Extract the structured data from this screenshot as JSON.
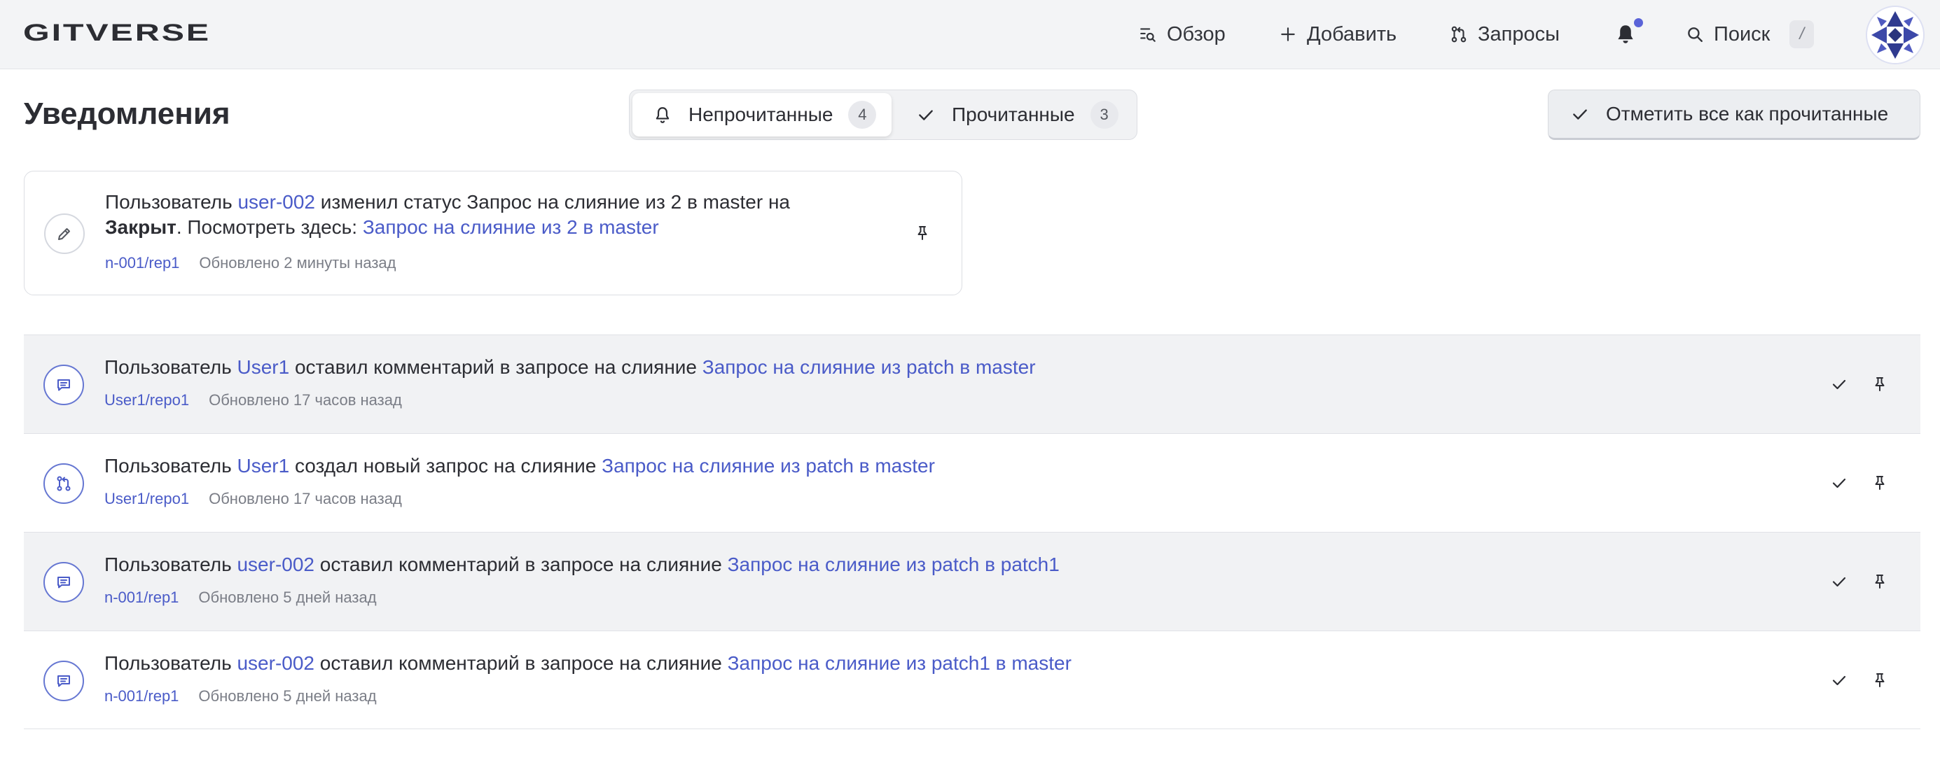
{
  "header": {
    "logo": "GITVERSE",
    "nav": {
      "overview": "Обзор",
      "add": "Добавить",
      "requests": "Запросы",
      "search": "Поиск",
      "search_shortcut": "/"
    }
  },
  "page": {
    "title": "Уведомления",
    "tabs": {
      "unread_label": "Непрочитанные",
      "unread_count": "4",
      "read_label": "Прочитанные",
      "read_count": "3"
    },
    "mark_all_label": "Отметить все как прочитанные"
  },
  "pinned": {
    "icon": "pencil-icon",
    "prefix": "Пользователь",
    "user": "user-002",
    "action": "изменил статус Запрос на слияние из 2 в master на",
    "status": "Закрыт",
    "suffix": ". Посмотреть здесь:",
    "link": "Запрос на слияние из 2 в master",
    "repo": "n-001/rep1",
    "time": "Обновлено 2 минуты назад"
  },
  "notifications": [
    {
      "icon": "comment-icon",
      "prefix": "Пользователь",
      "user": "User1",
      "action": "оставил комментарий в запросе на слияние",
      "link": "Запрос на слияние из patch в master",
      "repo": "User1/repo1",
      "time": "Обновлено 17 часов назад"
    },
    {
      "icon": "merge-request-icon",
      "prefix": "Пользователь",
      "user": "User1",
      "action": "создал новый запрос на слияние",
      "link": "Запрос на слияние из patch в master",
      "repo": "User1/repo1",
      "time": "Обновлено 17 часов назад"
    },
    {
      "icon": "comment-icon",
      "prefix": "Пользователь",
      "user": "user-002",
      "action": "оставил комментарий в запросе на слияние",
      "link": "Запрос на слияние из patch в patch1",
      "repo": "n-001/rep1",
      "time": "Обновлено 5 дней назад"
    },
    {
      "icon": "comment-icon",
      "prefix": "Пользователь",
      "user": "user-002",
      "action": "оставил комментарий в запросе на слияние",
      "link": "Запрос на слияние из patch1 в master",
      "repo": "n-001/rep1",
      "time": "Обновлено 5 дней назад"
    }
  ],
  "colors": {
    "accent": "#4a5bc8",
    "header_bg": "#f3f4f6",
    "row_alt_bg": "#f1f2f4",
    "notification_dot": "#5a63d8"
  }
}
